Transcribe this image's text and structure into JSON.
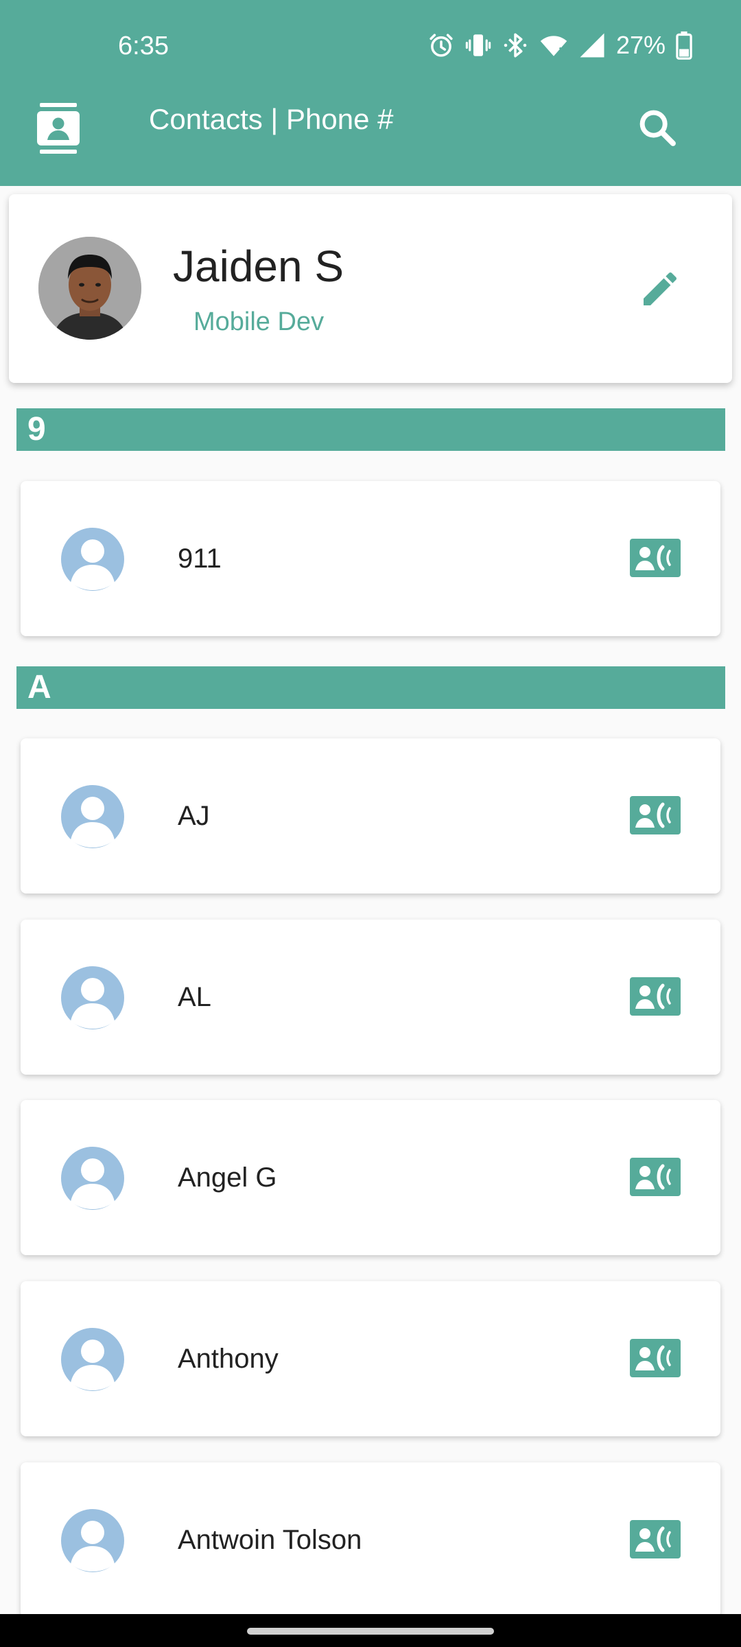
{
  "status_bar": {
    "time": "6:35",
    "battery": "27%",
    "icons": [
      "alarm-icon",
      "vibrate-icon",
      "bluetooth-icon",
      "wifi-icon",
      "signal-icon",
      "battery-icon"
    ]
  },
  "app_bar": {
    "title": "Contacts | Phone #",
    "icon": "contacts-book-icon",
    "action_icon": "search-icon"
  },
  "profile": {
    "name": "Jaiden S",
    "role": "Mobile Dev",
    "action_icon": "edit-pencil-icon"
  },
  "sections": [
    {
      "letter": "9",
      "contacts": [
        {
          "name": "911"
        }
      ]
    },
    {
      "letter": "A",
      "contacts": [
        {
          "name": "AJ"
        },
        {
          "name": "AL"
        },
        {
          "name": "Angel G"
        },
        {
          "name": "Anthony"
        },
        {
          "name": "Antwoin Tolson"
        }
      ]
    }
  ],
  "colors": {
    "primary": "#56ab9a",
    "avatar_placeholder": "#9bc0e0",
    "background": "#fafafa",
    "text_dark": "#222222"
  }
}
